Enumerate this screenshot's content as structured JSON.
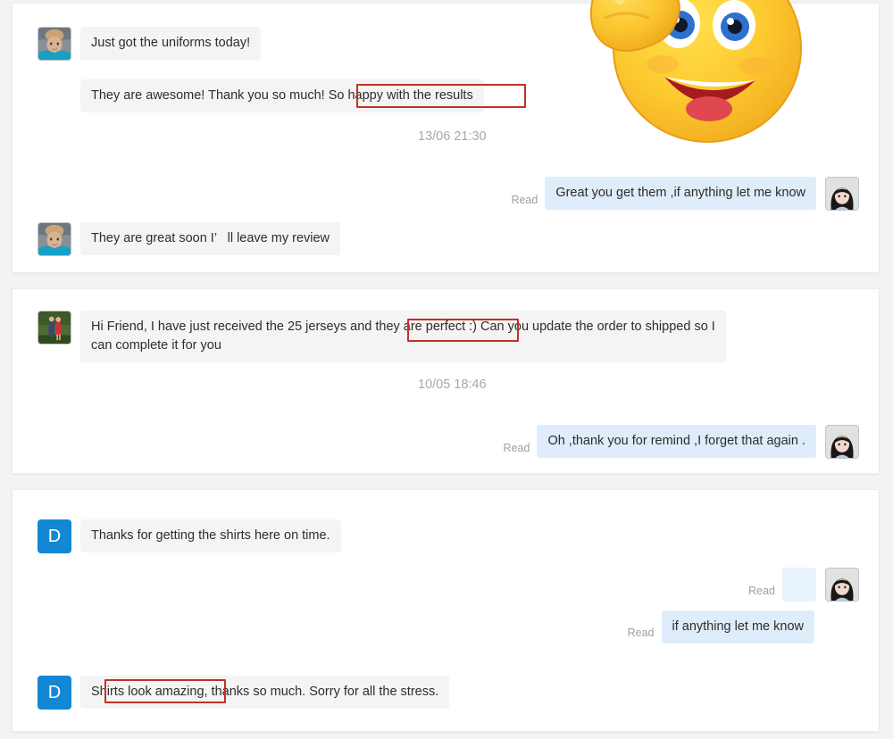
{
  "theme": {
    "page_background": "#f3f3f3",
    "card_background": "#ffffff",
    "incoming_bubble": "#f4f4f4",
    "outgoing_bubble": "#dfecfa",
    "sticker_bubble": "#e8f2fc",
    "highlight_border": "#c2302a",
    "avatar_letter_bg": "#1287d3",
    "timestamp_color": "#a4a9ad",
    "read_label_color": "#9aa0a6"
  },
  "labels": {
    "read": "Read"
  },
  "conversations": [
    {
      "id": "conversation-1",
      "avatar": {
        "name": "avatar-blonde-woman",
        "type": "photo",
        "description": "blonde-woman-in-teal-top"
      },
      "messages": [
        {
          "direction": "incoming",
          "text": "Just got the uniforms today!"
        },
        {
          "direction": "incoming",
          "text": "They are awesome! Thank you so much! So happy with the results",
          "highlight": "So happy with the results"
        },
        {
          "direction": "timestamp",
          "text": "13/06 21:30"
        },
        {
          "direction": "outgoing",
          "text": "Great you get them ,if anything let me know",
          "status": "Read"
        },
        {
          "direction": "incoming",
          "text": "They are great soon I’   ll leave my review"
        }
      ],
      "sticker_overlay": {
        "name": "thumbs-up-smiley-emoji",
        "description": "large yellow smiley face giving a thumbs up"
      }
    },
    {
      "id": "conversation-2",
      "avatar": {
        "name": "avatar-couple-photo",
        "type": "photo",
        "description": "couple-outdoors-man-in-suit-woman-in-red-dress"
      },
      "messages": [
        {
          "direction": "incoming",
          "text": "Hi Friend, I have just received the 25 jerseys and they are perfect :) Can you update the order to shipped so I\ncan complete it for you",
          "highlight": "they are perfect"
        },
        {
          "direction": "timestamp",
          "text": "10/05 18:46"
        },
        {
          "direction": "outgoing",
          "text": "Oh ,thank you for remind ,I forget that again .",
          "status": "Read"
        }
      ]
    },
    {
      "id": "conversation-3",
      "avatar": {
        "name": "avatar-letter-d",
        "type": "letter",
        "letter": "D"
      },
      "messages": [
        {
          "direction": "incoming",
          "text": "Thanks for getting the shirts here on time."
        },
        {
          "direction": "outgoing-sticker",
          "sticker": "headband-smiley-emoji",
          "status": "Read"
        },
        {
          "direction": "outgoing",
          "text": "if anything let me know",
          "status": "Read"
        },
        {
          "direction": "incoming",
          "text": "Shirts look amazing, thanks so much. Sorry for all the stress.",
          "highlight": "Shirts look amazing,"
        }
      ]
    }
  ],
  "self_avatar": {
    "name": "avatar-dark-hair-woman",
    "type": "photo",
    "description": "woman-with-black-bangs"
  }
}
